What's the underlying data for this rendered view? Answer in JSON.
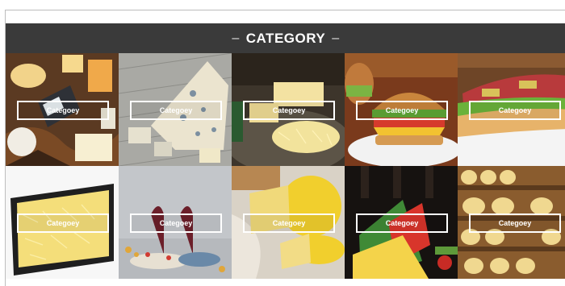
{
  "header": {
    "title": "CATEGORY",
    "dash_left": "–",
    "dash_right": "–"
  },
  "tiles": [
    {
      "label": "Categoey",
      "image": "cheese-board"
    },
    {
      "label": "Categoey",
      "image": "blue-cheese-on-wood"
    },
    {
      "label": "Categoey",
      "image": "grated-cheese"
    },
    {
      "label": "Categoey",
      "image": "cheeseburger"
    },
    {
      "label": "Categoey",
      "image": "ham-sandwich"
    },
    {
      "label": "Categoey",
      "image": "shredded-cheese-tray"
    },
    {
      "label": "Categoey",
      "image": "wine-and-snacks"
    },
    {
      "label": "Categoey",
      "image": "cheese-wheel"
    },
    {
      "label": "Categoey",
      "image": "cheese-wedges"
    },
    {
      "label": "Categoey",
      "image": "cheese-aging-shelves"
    }
  ]
}
